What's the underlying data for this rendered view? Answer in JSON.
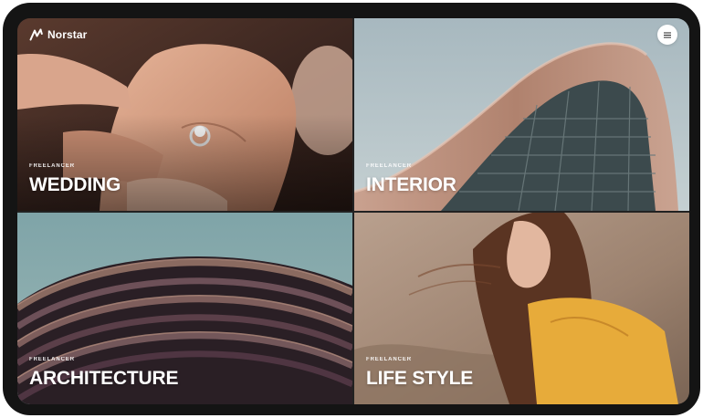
{
  "brand": {
    "name": "Norstar"
  },
  "tiles": [
    {
      "eyebrow": "FREELANCER",
      "title": "WEDDING"
    },
    {
      "eyebrow": "FREELANCER",
      "title": "INTERIOR"
    },
    {
      "eyebrow": "FREELANCER",
      "title": "ARCHITECTURE"
    },
    {
      "eyebrow": "FREELANCER",
      "title": "LIFE STYLE"
    }
  ],
  "icons": {
    "logo": "norstar-logo-icon",
    "menu": "hamburger-menu-icon"
  },
  "colors": {
    "device": "#141414",
    "caption": "#ffffff",
    "menu_button": "#ffffff"
  }
}
